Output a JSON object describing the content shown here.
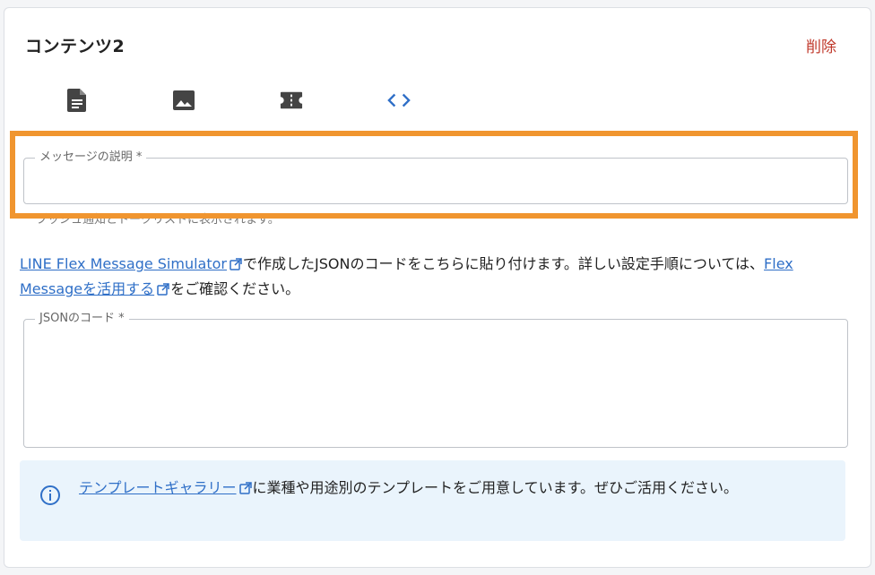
{
  "header": {
    "title": "コンテンツ2",
    "delete_label": "削除"
  },
  "tabs": [
    {
      "icon": "document-icon"
    },
    {
      "icon": "image-icon"
    },
    {
      "icon": "ticket-icon"
    },
    {
      "icon": "code-icon",
      "selected": true
    }
  ],
  "description_field": {
    "label": "メッセージの説明 *",
    "value": "",
    "helper": "プッシュ通知とトークリストに表示されます。"
  },
  "instructions": {
    "link1": "LINE Flex Message Simulator",
    "text1": "で作成したJSONのコードをこちらに貼り付けます。詳しい設定手順については、",
    "link2": "Flex Messageを活用する",
    "text2": "をご確認ください。"
  },
  "json_field": {
    "label": "JSONのコード *",
    "value": ""
  },
  "info": {
    "link": "テンプレートギャラリー",
    "text": "に業種や用途別のテンプレートをご用意しています。ぜひご活用ください。"
  },
  "colors": {
    "accent": "#2f6fc7",
    "delete": "#c0392b",
    "highlight": "#f0952f",
    "info_bg": "#eaf4fc"
  }
}
